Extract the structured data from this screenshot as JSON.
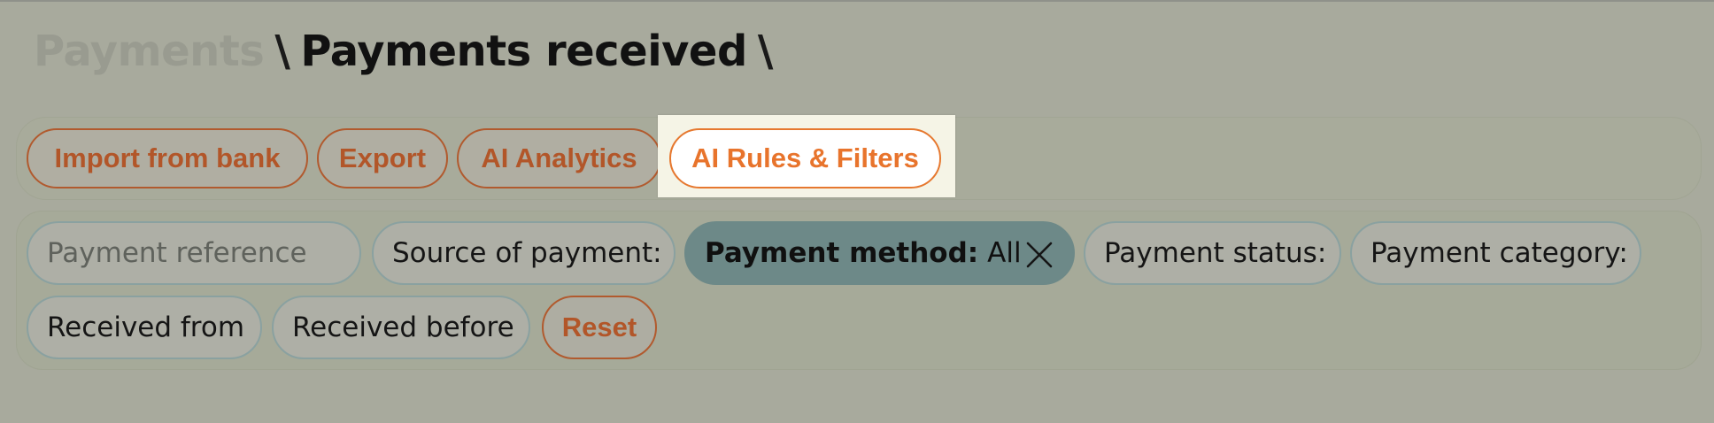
{
  "breadcrumb": {
    "root": "Payments",
    "separator": "\\",
    "current": "Payments received",
    "trailing": "\\"
  },
  "toolbar": {
    "import_label": "Import from bank",
    "export_label": "Export",
    "analytics_label": "AI Analytics",
    "rules_label": "AI Rules & Filters"
  },
  "filters": {
    "payment_reference_placeholder": "Payment reference",
    "source_label": "Source of payment:",
    "method_label": "Payment method:",
    "method_value": "All",
    "status_label": "Payment status:",
    "category_label": "Payment category:",
    "received_from_label": "Received from",
    "received_before_label": "Received before",
    "reset_label": "Reset"
  },
  "colors": {
    "accent": "#b25629",
    "highlight_accent": "#e8742c",
    "active_chip": "#6d8988",
    "background": "#a8aa9d"
  },
  "icons": {
    "clear_filter": "close-icon"
  }
}
